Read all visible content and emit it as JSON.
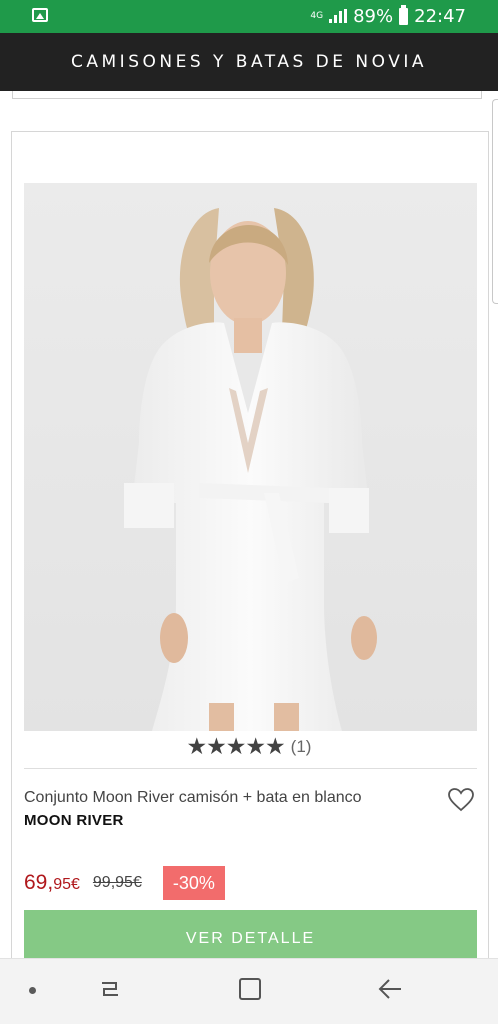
{
  "status_bar": {
    "network": "4G",
    "battery": "89%",
    "time": "22:47",
    "icons": [
      "gallery-icon",
      "signal-icon",
      "battery-icon"
    ]
  },
  "header": {
    "title": "CAMISONES Y BATAS DE NOVIA"
  },
  "product": {
    "image_alt": "product-photo",
    "rating_stars": "★★★★★",
    "rating_count": "(1)",
    "name": "Conjunto Moon River camisón + bata en blanco",
    "brand": "MOON RIVER",
    "price_whole": "69,",
    "price_cents": "95€",
    "price_old": "99,95€",
    "discount": "-30%",
    "cta": "VER DETALLE",
    "wishlist_icon": "heart-icon"
  },
  "colors": {
    "status_bar": "#1f9a4a",
    "header": "#222222",
    "price": "#b0181c",
    "discount_badge": "#f26c6c",
    "cta": "#85c985"
  },
  "nav": {
    "icons": [
      "dot-icon",
      "recent-apps-icon",
      "home-icon",
      "back-icon"
    ]
  }
}
